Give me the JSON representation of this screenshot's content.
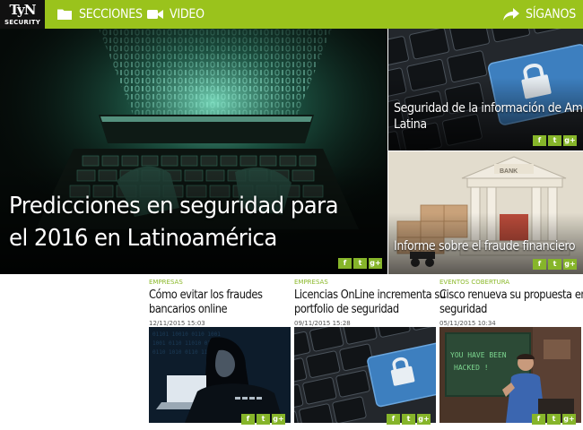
{
  "nav": {
    "logo_mark": "TyN",
    "logo_sub": "SECURITY",
    "secciones": "SECCIONES",
    "video": "VIDEO",
    "siganos": "SÍGANOS",
    "accent": "#9ac31c"
  },
  "hero": {
    "title": "Predicciones en seguridad para el 2016 en Latinoamérica",
    "image": "hacker-keyboard-binary"
  },
  "side": [
    {
      "title_lines": [
        "Seguridad de la información de América",
        "Latina"
      ],
      "image": "lock-key-keyboard"
    },
    {
      "title_lines": [
        "Informe sobre el fraude financiero"
      ],
      "image": "bank-building"
    }
  ],
  "share": {
    "facebook": "f",
    "twitter": "t",
    "googleplus": "g+"
  },
  "articles": [
    {
      "category": "EMPRESAS",
      "title_lines": [
        "Cómo evitar los fraudes",
        "bancarios online"
      ],
      "date": "12/11/2015 15:03",
      "image": "hooded-hacker"
    },
    {
      "category": "EMPRESAS",
      "title_lines": [
        "Licencias OnLine incrementa su",
        "portfolio de seguridad"
      ],
      "date": "09/11/2015 15:28",
      "image": "lock-key-keyboard"
    },
    {
      "category": "EVENTOS COBERTURA",
      "title_lines": [
        "Cisco renueva su propuesta en",
        "seguridad"
      ],
      "date": "05/11/2015 10:34",
      "image": "speaker-hacked-screen",
      "screen_text": "YOU HAVE BEEN HACKED !"
    }
  ]
}
